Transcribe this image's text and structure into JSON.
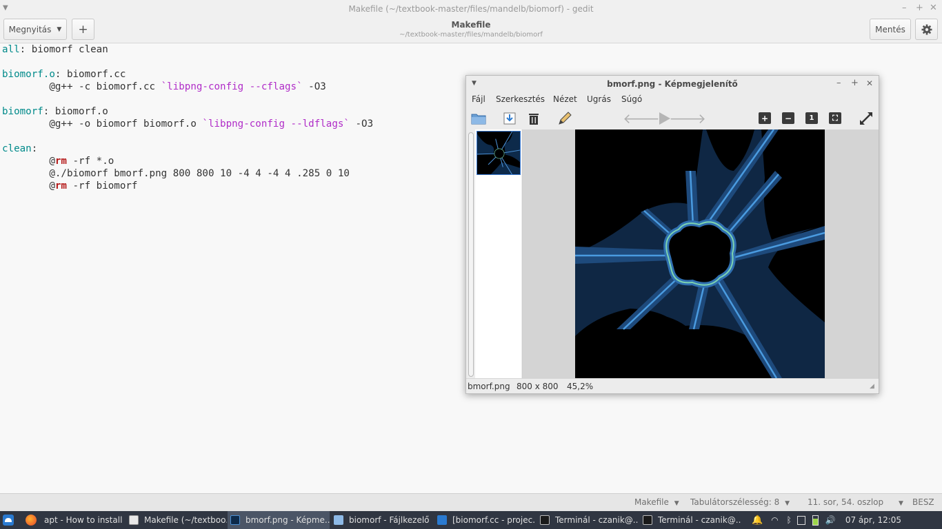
{
  "gedit": {
    "window_title": "Makefile (~/textbook-master/files/mandelb/biomorf) - gedit",
    "open_button": "Megnyitás",
    "new_tab_button": "+",
    "doc_title": "Makefile",
    "doc_path": "~/textbook-master/files/mandelb/biomorf",
    "save_button": "Mentés",
    "code": {
      "l1_target": "all",
      "l1_rest": ": biomorf clean",
      "l3_target": "biomorf.o",
      "l3_rest": ": biomorf.cc",
      "l4_pre": "        @g++ -c biomorf.cc ",
      "l4_sub": "`libpng-config --cflags`",
      "l4_post": " -O3",
      "l6_target": "biomorf",
      "l6_rest": ": biomorf.o",
      "l7_pre": "        @g++ -o biomorf biomorf.o ",
      "l7_sub": "`libpng-config --ldflags`",
      "l7_post": " -O3",
      "l9_target": "clean",
      "l9_rest": ":",
      "l10_pre": "        @",
      "l10_kw": "rm",
      "l10_post": " -rf *.o",
      "l11": "        @./biomorf bmorf.png 800 800 10 -4 4 -4 4 .285 0 10",
      "l12_pre": "        @",
      "l12_kw": "rm",
      "l12_post": " -rf biomorf"
    },
    "status": {
      "language": "Makefile",
      "tab_width": "Tabulátorszélesség: 8",
      "position": "11. sor, 54. oszlop",
      "insert_mode": "BESZ"
    }
  },
  "viewer": {
    "title": "bmorf.png - Képmegjelenítő",
    "menu": [
      "Fájl",
      "Szerkesztés",
      "Nézet",
      "Ugrás",
      "Súgó"
    ],
    "status": {
      "filename": "bmorf.png",
      "dimensions": "800 x 800",
      "zoom": "45,2%"
    },
    "zoom_fit_label": "1"
  },
  "taskbar": {
    "items": [
      "apt - How to install ...",
      "Makefile (~/textboo...",
      "bmorf.png - Képme...",
      "biomorf - Fájlkezelő",
      "[biomorf.cc - projec...",
      "Terminál - czanik@...",
      "Terminál - czanik@..."
    ],
    "clock": "07 ápr, 12:05"
  },
  "colors": {
    "code_target": "#008a8a",
    "code_backtick": "#b02cc8",
    "code_keyword": "#b51a1a",
    "taskbar_bg": "#303642",
    "biomorf_blue": "#2a5a8c"
  }
}
